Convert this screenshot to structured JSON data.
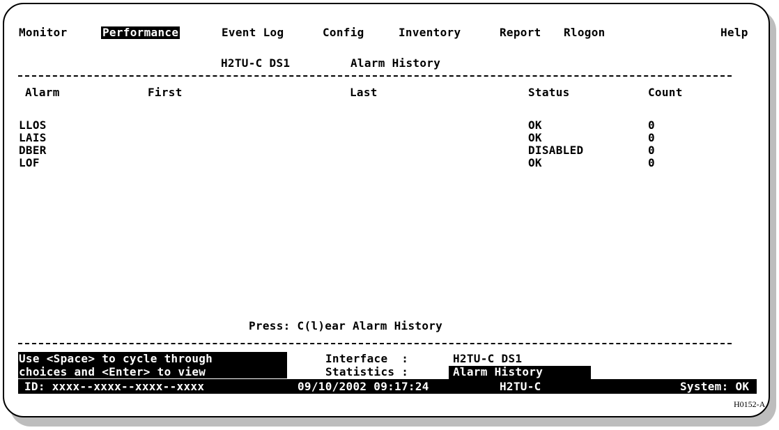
{
  "menu": {
    "monitor": "Monitor",
    "performance": "Performance",
    "event_log": "Event Log",
    "config": "Config",
    "inventory": "Inventory",
    "report": "Report",
    "rlogon": "Rlogon",
    "help": "Help"
  },
  "screen_title": {
    "interface": "H2TU-C DS1",
    "page": "Alarm History"
  },
  "table": {
    "headers": {
      "alarm": "Alarm",
      "first": "First",
      "last": "Last",
      "status": "Status",
      "count": "Count"
    },
    "rows": [
      {
        "alarm": "LLOS",
        "status": "OK",
        "count": "0"
      },
      {
        "alarm": "LAIS",
        "status": "OK",
        "count": "0"
      },
      {
        "alarm": "DBER",
        "status": "DISABLED",
        "count": "0"
      },
      {
        "alarm": "LOF",
        "status": "OK",
        "count": "0"
      }
    ]
  },
  "prompt": "Press: C(l)ear Alarm History",
  "footer": {
    "hint_line1": "Use <Space> to cycle through",
    "hint_line2": "choices and <Enter> to view",
    "interface_label": "Interface  :",
    "interface_value": "H2TU-C DS1",
    "statistics_label": "Statistics :",
    "statistics_value": "Alarm History",
    "id": "ID: xxxx--xxxx--xxxx--xxxx",
    "datetime": "09/10/2002 09:17:24",
    "unit": "H2TU-C",
    "system_status": "System: OK"
  },
  "figure_id": "H0152-A"
}
